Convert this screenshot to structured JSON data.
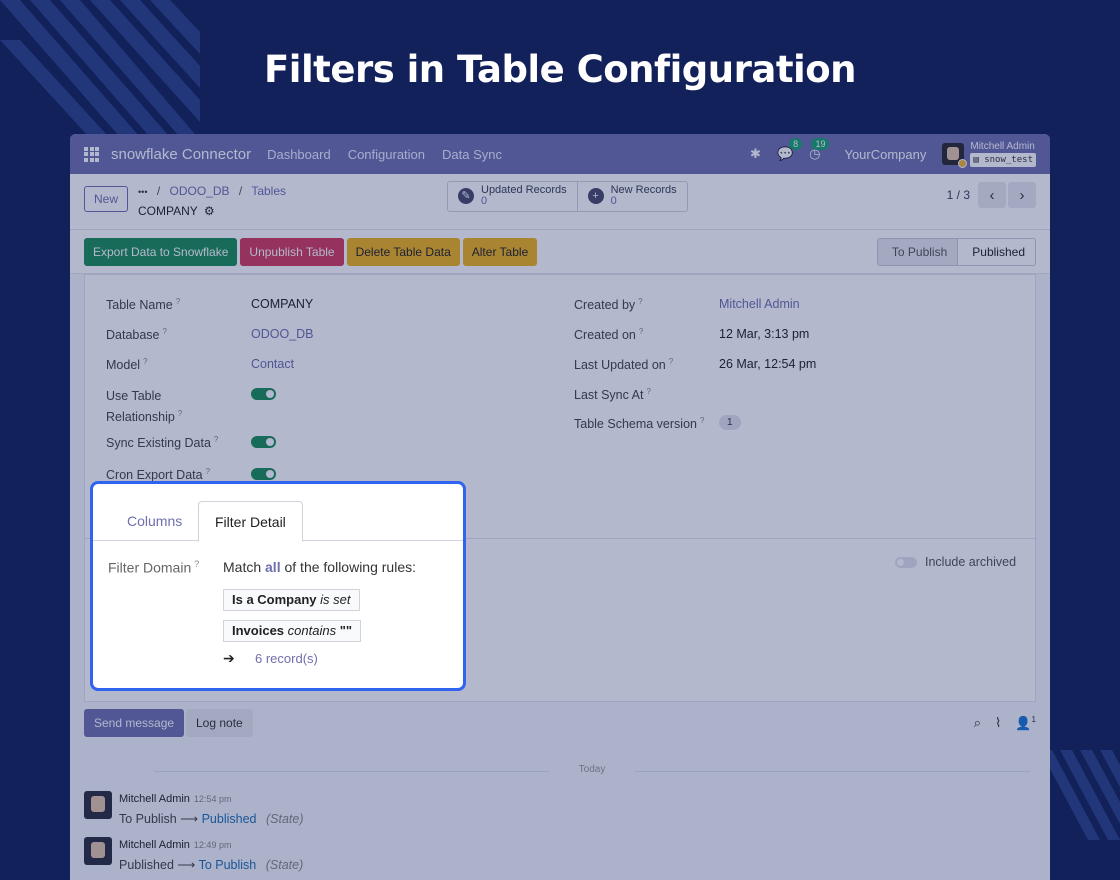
{
  "hero": {
    "title": "Filters in Table Configuration"
  },
  "navbar": {
    "app_name": "snowflake Connector",
    "menu": [
      "Dashboard",
      "Configuration",
      "Data Sync"
    ],
    "messages_badge": "8",
    "activity_badge": "19",
    "company": "YourCompany",
    "user_name": "Mitchell Admin",
    "db_name": "snow_test"
  },
  "control": {
    "new_label": "New",
    "breadcrumb": {
      "ellipsis": "•••",
      "items": [
        "ODOO_DB",
        "Tables"
      ],
      "current": "COMPANY"
    },
    "smart_buttons": [
      {
        "label": "Updated Records",
        "count": "0",
        "icon": "pencil-icon"
      },
      {
        "label": "New Records",
        "count": "0",
        "icon": "plus-icon"
      }
    ],
    "pager": "1 / 3"
  },
  "actions": [
    "Export Data to Snowflake",
    "Unpublish Table",
    "Delete Table Data",
    "Alter Table"
  ],
  "stages": [
    "To Publish",
    "Published"
  ],
  "form": {
    "left": [
      {
        "label": "Table Name",
        "value": "COMPANY"
      },
      {
        "label": "Database",
        "value": "ODOO_DB"
      },
      {
        "label": "Model",
        "value": "Contact"
      },
      {
        "label": "Use Table Relationship",
        "label_1": "Use Table",
        "label_2": "Relationship",
        "value": "on"
      },
      {
        "label": "Sync Existing Data",
        "value": "on"
      },
      {
        "label": "Cron Export Data",
        "value": "on"
      }
    ],
    "right": [
      {
        "label": "Created by",
        "value": "Mitchell Admin"
      },
      {
        "label": "Created on",
        "value": "12 Mar, 3:13 pm"
      },
      {
        "label": "Last Updated on",
        "value": "26 Mar, 12:54 pm"
      },
      {
        "label": "Last Sync At",
        "value": ""
      },
      {
        "label": "Table Schema version",
        "value": "1"
      }
    ],
    "include_archived": "Include archived"
  },
  "filter_panel": {
    "tabs": [
      "Columns",
      "Filter Detail"
    ],
    "label": "Filter Domain",
    "match_prefix": "Match",
    "match_word": "all",
    "match_suffix": "of the following rules:",
    "rules": [
      {
        "field": "Is a Company",
        "operator": "is set",
        "value": ""
      },
      {
        "field": "Invoices",
        "operator": "contains",
        "value": "\"\""
      }
    ],
    "arrow": "➔",
    "records": "6 record(s)"
  },
  "chatter": {
    "send_message": "Send message",
    "log_note": "Log note",
    "followers": "1",
    "today": "Today",
    "messages": [
      {
        "author": "Mitchell Admin",
        "time": "12:54 pm",
        "from": "To Publish",
        "to": "Published",
        "field": "(State)"
      },
      {
        "author": "Mitchell Admin",
        "time": "12:49 pm",
        "from": "Published",
        "to": "To Publish",
        "field": "(State)"
      }
    ]
  },
  "colors": {
    "background": "#12215a",
    "accent": "#6f6fad",
    "highlight_border": "#2f63f0",
    "green": "#1b8e55",
    "red": "#d33a5a",
    "yellow": "#f1b31a"
  }
}
